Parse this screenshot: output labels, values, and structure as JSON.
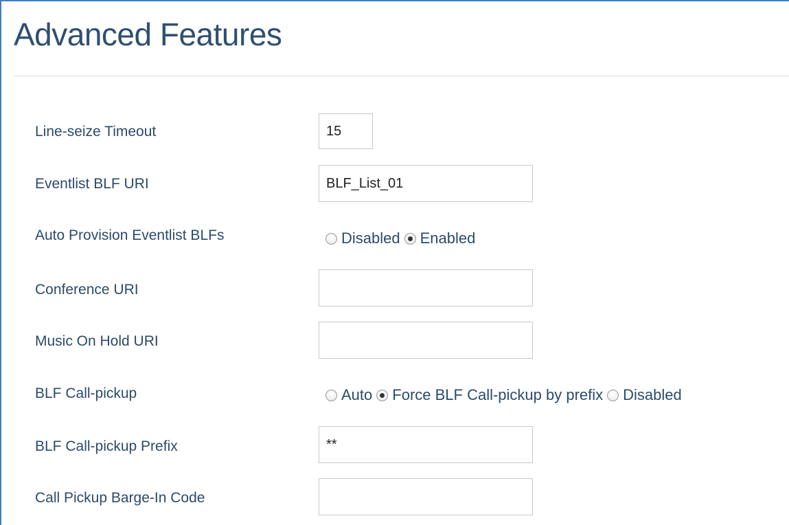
{
  "page": {
    "title": "Advanced Features"
  },
  "fields": {
    "line_seize_timeout": {
      "label": "Line-seize Timeout",
      "value": "15"
    },
    "eventlist_blf_uri": {
      "label": "Eventlist BLF URI",
      "value": "BLF_List_01"
    },
    "auto_provision_eventlist_blfs": {
      "label": "Auto Provision Eventlist BLFs",
      "options": [
        "Disabled",
        "Enabled"
      ],
      "selected": "Enabled"
    },
    "conference_uri": {
      "label": "Conference URI",
      "value": ""
    },
    "music_on_hold_uri": {
      "label": "Music On Hold URI",
      "value": ""
    },
    "blf_call_pickup": {
      "label": "BLF Call-pickup",
      "options": [
        "Auto",
        "Force BLF Call-pickup by prefix",
        "Disabled"
      ],
      "selected": "Force BLF Call-pickup by prefix"
    },
    "blf_call_pickup_prefix": {
      "label": "BLF Call-pickup Prefix",
      "value": "**"
    },
    "call_pickup_barge_in_code": {
      "label": "Call Pickup Barge-In Code",
      "value": ""
    }
  },
  "colors": {
    "title": "#2f4f70",
    "label": "#2b4a6b",
    "frame_border": "#3f7fc0",
    "input_border": "#c8c8c8"
  }
}
